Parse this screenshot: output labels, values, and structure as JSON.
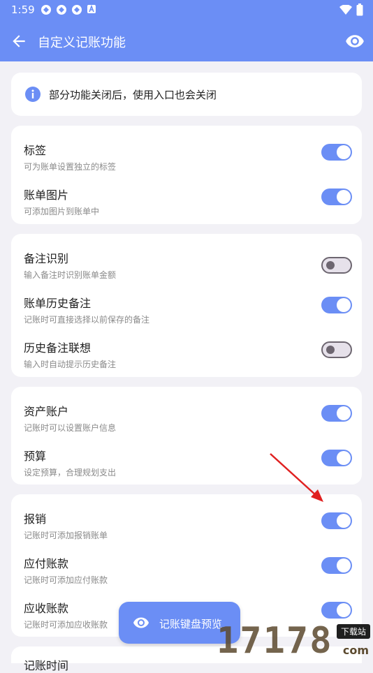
{
  "status_bar": {
    "time": "1:59"
  },
  "app_bar": {
    "title": "自定义记账功能",
    "back_icon": "arrow-left-icon",
    "preview_icon": "eye-icon"
  },
  "info": {
    "text": "部分功能关闭后，使用入口也会关闭"
  },
  "groups": [
    {
      "items": [
        {
          "title": "标签",
          "subtitle": "可为账单设置独立的标签",
          "enabled": true
        },
        {
          "title": "账单图片",
          "subtitle": "可添加图片到账单中",
          "enabled": true
        }
      ]
    },
    {
      "items": [
        {
          "title": "备注识别",
          "subtitle": "输入备注时识别账单金额",
          "enabled": false
        },
        {
          "title": "账单历史备注",
          "subtitle": "记账时可直接选择以前保存的备注",
          "enabled": true
        },
        {
          "title": "历史备注联想",
          "subtitle": "输入时自动提示历史备注",
          "enabled": false
        }
      ]
    },
    {
      "items": [
        {
          "title": "资产账户",
          "subtitle": "记账时可以设置账户信息",
          "enabled": true
        },
        {
          "title": "预算",
          "subtitle": "设定预算，合理规划支出",
          "enabled": true
        }
      ]
    },
    {
      "items": [
        {
          "title": "报销",
          "subtitle": "记账时可添加报销账单",
          "enabled": true
        },
        {
          "title": "应付账款",
          "subtitle": "记账时可添加应付账款",
          "enabled": true
        },
        {
          "title": "应收账款",
          "subtitle": "记账时可添加应收账款",
          "enabled": true
        }
      ]
    }
  ],
  "partial_item": {
    "title": "记账时间"
  },
  "fab": {
    "label": "记账键盘预览"
  },
  "watermark": {
    "number": "17178",
    "tag": "下载站",
    "domain": "com"
  },
  "colors": {
    "accent": "#6b8ef5",
    "background": "#f2f1f6",
    "arrow": "#e02020"
  }
}
